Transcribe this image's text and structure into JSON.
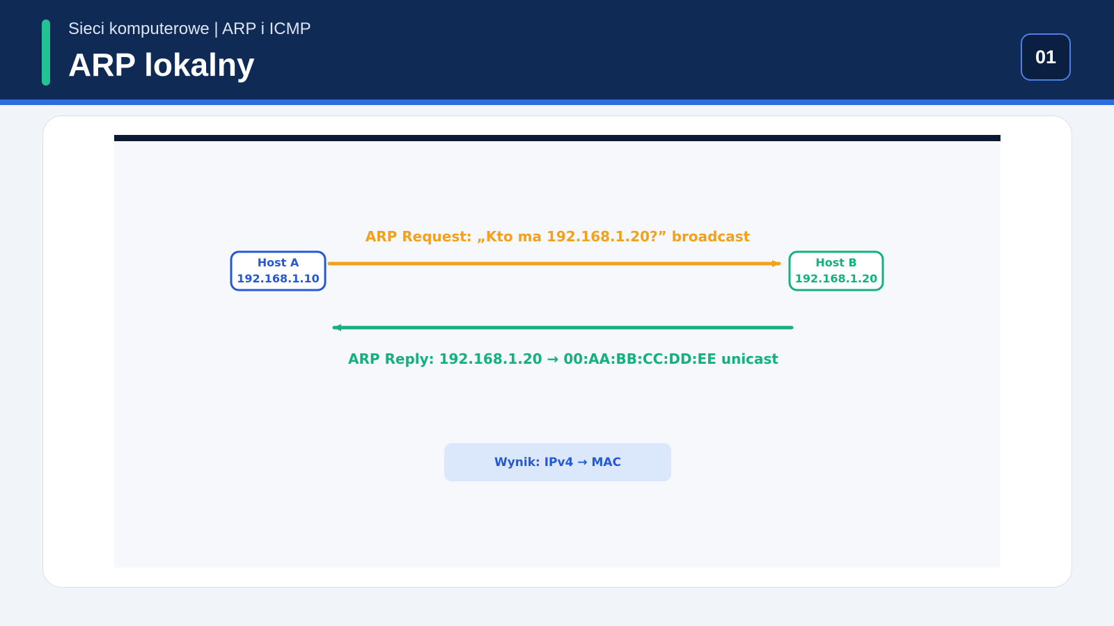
{
  "header": {
    "subtitle": "Sieci komputerowe | ARP i ICMP",
    "title": "ARP lokalny",
    "page_number": "01"
  },
  "diagram": {
    "host_a": {
      "name": "Host A",
      "ip": "192.168.1.10"
    },
    "host_b": {
      "name": "Host B",
      "ip": "192.168.1.20"
    },
    "request_label": "ARP Request: „Kto ma 192.168.1.20?”  broadcast",
    "reply_label": "ARP Reply: 192.168.1.20 → 00:AA:BB:CC:DD:EE  unicast",
    "result_label": "Wynik: IPv4 → MAC"
  },
  "colors": {
    "header_bg": "#0e2a55",
    "accent": "#23c294",
    "host_a": "#2458d6",
    "host_b": "#14b17e",
    "request": "#f2a11c",
    "reply": "#14b17e"
  }
}
